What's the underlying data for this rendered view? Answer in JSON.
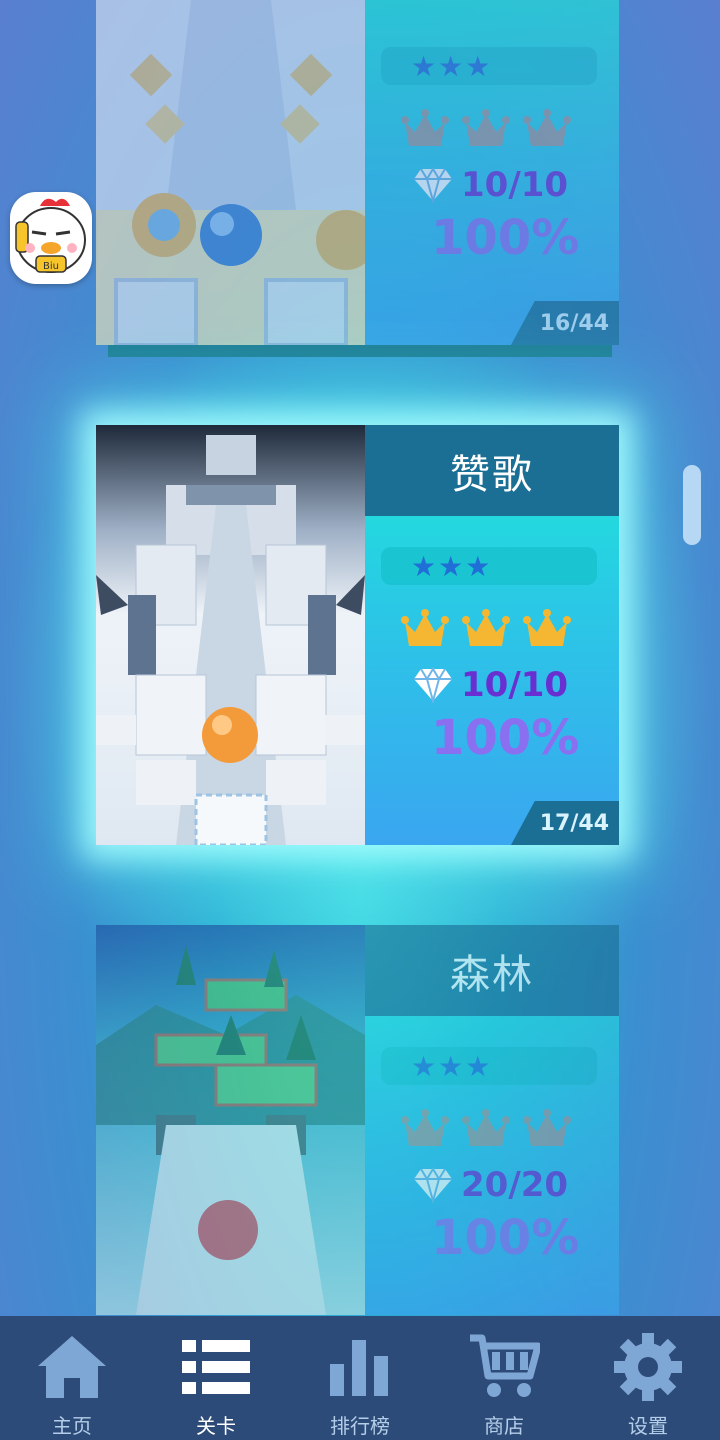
{
  "colors": {
    "accent": "#1b6f95",
    "crown_gold": "#f5b731",
    "crown_grey": "#9a9a9a",
    "navbar": "#2d4b79"
  },
  "levels": [
    {
      "title": "",
      "stars": "★★★",
      "gems": "10/10",
      "percent": "100%",
      "level": "16/44"
    },
    {
      "title": "赞歌",
      "stars": "★★★",
      "gems": "10/10",
      "percent": "100%",
      "level": "17/44"
    },
    {
      "title": "森林",
      "stars": "★★★",
      "gems": "20/20",
      "percent": "100%"
    }
  ],
  "mascot": {
    "badge": "Biu"
  },
  "nav": {
    "items": [
      {
        "label": "主页",
        "icon": "home-icon"
      },
      {
        "label": "关卡",
        "icon": "list-icon"
      },
      {
        "label": "排行榜",
        "icon": "leaderboard-icon"
      },
      {
        "label": "商店",
        "icon": "cart-icon"
      },
      {
        "label": "设置",
        "icon": "gear-icon"
      }
    ],
    "active": "关卡"
  }
}
